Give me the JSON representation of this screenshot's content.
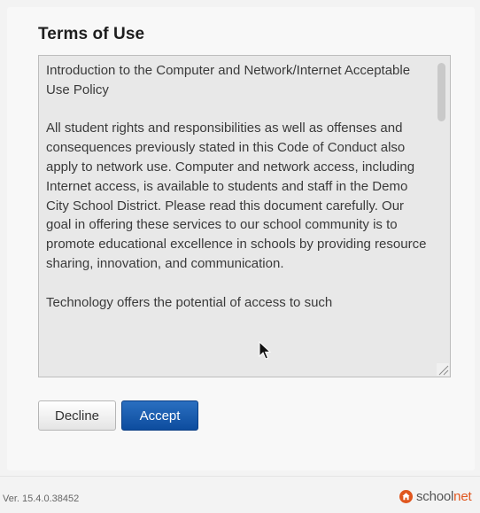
{
  "terms": {
    "title": "Terms of Use",
    "paragraphs": [
      "Introduction to the Computer and Network/Internet Acceptable Use Policy",
      "All student rights and responsibilities as well as offenses and consequences previously stated in this Code of Conduct also apply to network use. Computer and network access, including Internet access, is available to students and staff in the Demo City School District. Please read this document carefully. Our goal in offering these services to our school community is to promote educational excellence in schools by providing resource sharing, innovation, and communication.",
      "Technology offers the potential of access to such"
    ]
  },
  "actions": {
    "decline_label": "Decline",
    "accept_label": "Accept"
  },
  "footer": {
    "version": "Ver. 15.4.0.38452",
    "brand_main": "school",
    "brand_accent": "net",
    "brand_icon": "house-icon"
  },
  "colors": {
    "accept_button": "#0d4c9e",
    "brand_accent": "#e0561e"
  }
}
